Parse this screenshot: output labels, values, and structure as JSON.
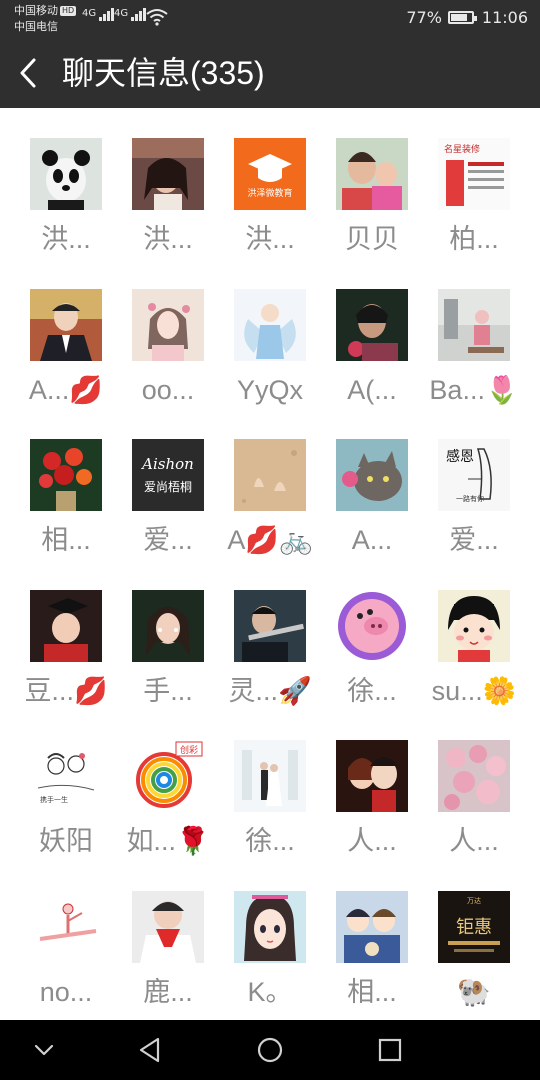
{
  "status_bar": {
    "carrier1": "中国移动",
    "hd_badge": "HD",
    "carrier2": "中国电信",
    "net1": "4G",
    "net2": "4G",
    "battery_percent": "77%",
    "battery_level": 0.77,
    "time": "11:06"
  },
  "header": {
    "title": "聊天信息(335)"
  },
  "members": [
    {
      "name": "洪...",
      "avatar": "panda-avatar"
    },
    {
      "name": "洪...",
      "avatar": "girl-photo-avatar"
    },
    {
      "name": "洪...",
      "avatar": "graduation-cap-avatar",
      "logo_text": "洪泽微教育"
    },
    {
      "name": "贝贝",
      "avatar": "mother-child-avatar"
    },
    {
      "name": "柏...",
      "avatar": "poster-avatar"
    },
    {
      "name": "A...💋",
      "avatar": "man-suit-avatar"
    },
    {
      "name": "oo...",
      "avatar": "girl-flowers-avatar"
    },
    {
      "name": "YyQx",
      "avatar": "angel-avatar"
    },
    {
      "name": "A(...",
      "avatar": "woman-portrait-avatar"
    },
    {
      "name": "Ba...🌷",
      "avatar": "child-room-avatar"
    },
    {
      "name": "相...",
      "avatar": "flower-bouquet-avatar"
    },
    {
      "name": "爱...",
      "avatar": "aishon-logo-avatar",
      "logo_text": "Aishon"
    },
    {
      "name": "A💋🚲",
      "avatar": "sand-hands-avatar"
    },
    {
      "name": "A...",
      "avatar": "cat-avatar"
    },
    {
      "name": "爱...",
      "avatar": "praying-hands-avatar"
    },
    {
      "name": "豆...💋",
      "avatar": "graduate-child-avatar"
    },
    {
      "name": "手...",
      "avatar": "woman-selfie-avatar"
    },
    {
      "name": "灵...🚀",
      "avatar": "man-flute-avatar"
    },
    {
      "name": "徐...",
      "avatar": "pig-cartoon-avatar"
    },
    {
      "name": "su...🌼",
      "avatar": "maruko-cartoon-avatar"
    },
    {
      "name": "妖阳",
      "avatar": "couple-sketch-avatar"
    },
    {
      "name": "如...🌹",
      "avatar": "rainbow-logo-avatar",
      "logo_text": "创彩"
    },
    {
      "name": "徐...",
      "avatar": "wedding-avatar"
    },
    {
      "name": "人...",
      "avatar": "cartoon-couple-avatar"
    },
    {
      "name": "人...",
      "avatar": "pink-flowers-avatar"
    },
    {
      "name": "no...",
      "avatar": "dancer-cartoon-avatar"
    },
    {
      "name": "鹿...",
      "avatar": "child-red-scarf-avatar"
    },
    {
      "name": "K。",
      "avatar": "anime-girl-avatar"
    },
    {
      "name": "相...",
      "avatar": "anime-group-avatar"
    },
    {
      "name": "🐏",
      "avatar": "gold-poster-avatar"
    }
  ],
  "nav": [
    "collapse-icon",
    "back-triangle-icon",
    "home-circle-icon",
    "recents-square-icon"
  ]
}
